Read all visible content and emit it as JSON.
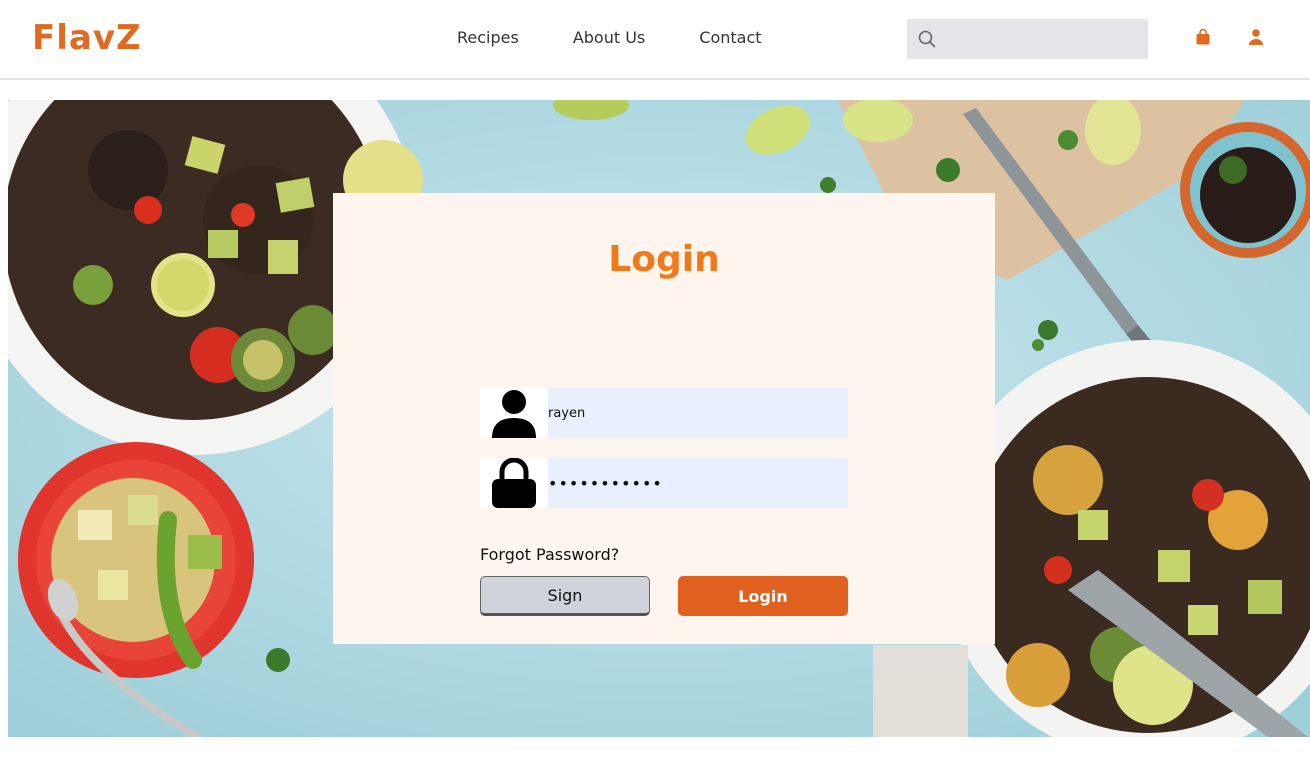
{
  "brand": {
    "name": "FlavZ",
    "color": "#e06a22"
  },
  "nav": {
    "items": [
      {
        "label": "Recipes"
      },
      {
        "label": "About Us"
      },
      {
        "label": "Contact"
      }
    ]
  },
  "search": {
    "value": "",
    "placeholder": "",
    "icon": "search-icon"
  },
  "header_icons": {
    "cart": "shopping-bag-icon",
    "user": "user-icon"
  },
  "login": {
    "title": "Login",
    "title_color": "#f07a1a",
    "username": {
      "value": "rayen",
      "icon": "user-icon"
    },
    "password": {
      "value": "•••••••••••",
      "icon": "lock-icon"
    },
    "forgot_label": "Forgot Password?",
    "sign_label": "Sign",
    "login_label": "Login",
    "login_button_color": "#e0601f"
  },
  "colors": {
    "card_bg": "#fdf5ee",
    "hero_bg": "#b6dde5",
    "input_bg": "#e8f0fd"
  }
}
